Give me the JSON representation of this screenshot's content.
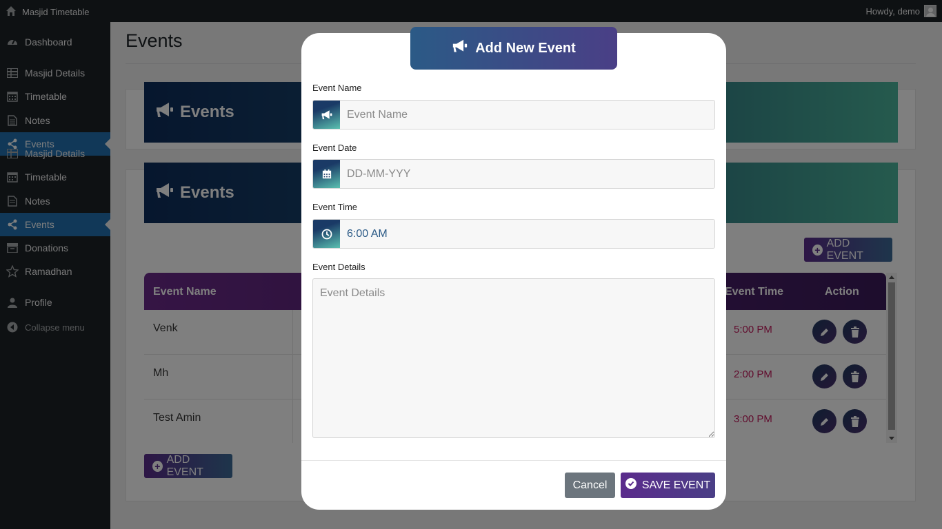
{
  "adminbar": {
    "site_title": "Masjid Timetable",
    "howdy": "Howdy, demo"
  },
  "sidebar": {
    "items": [
      {
        "label": "Dashboard",
        "icon": "dashboard-icon"
      },
      {
        "label": "Masjid Details",
        "icon": "table-icon"
      },
      {
        "label": "Timetable",
        "icon": "calendar-icon"
      },
      {
        "label": "Notes",
        "icon": "document-icon"
      },
      {
        "label": "Events",
        "icon": "share-icon"
      },
      {
        "label": "Masjid Details",
        "icon": "table-icon"
      },
      {
        "label": "Timetable",
        "icon": "calendar-icon"
      },
      {
        "label": "Notes",
        "icon": "document-icon"
      },
      {
        "label": "Events",
        "icon": "share-icon"
      },
      {
        "label": "Donations",
        "icon": "archive-icon"
      },
      {
        "label": "Ramadhan",
        "icon": "star-icon"
      },
      {
        "label": "Profile",
        "icon": "user-icon"
      },
      {
        "label": "Collapse menu",
        "icon": "collapse-icon"
      }
    ]
  },
  "page": {
    "title": "Events",
    "banner_title_1": "Events",
    "banner_title_2": "Events",
    "add_event_top": "ADD EVENT",
    "add_event_bottom": "ADD EVENT"
  },
  "table": {
    "headers": {
      "name": "Event Name",
      "time": "Event Time",
      "action": "Action"
    },
    "rows": [
      {
        "name": "Venk",
        "time": "5:00 PM"
      },
      {
        "name": "Mh",
        "time": "2:00 PM"
      },
      {
        "name": "Test Amin",
        "time": "3:00 PM"
      }
    ]
  },
  "modal": {
    "title": "Add New Event",
    "event_name_label": "Event Name",
    "event_name_placeholder": "Event Name",
    "event_date_label": "Event Date",
    "event_date_placeholder": "DD-MM-YYY",
    "event_time_label": "Event Time",
    "event_time_value": "6:00 AM",
    "event_details_label": "Event Details",
    "event_details_placeholder": "Event Details",
    "cancel": "Cancel",
    "save": "SAVE EVENT"
  },
  "colors": {
    "accent_purple": "#5b2c8c",
    "wp_blue": "#2271b1",
    "time_red": "#c2185b"
  }
}
